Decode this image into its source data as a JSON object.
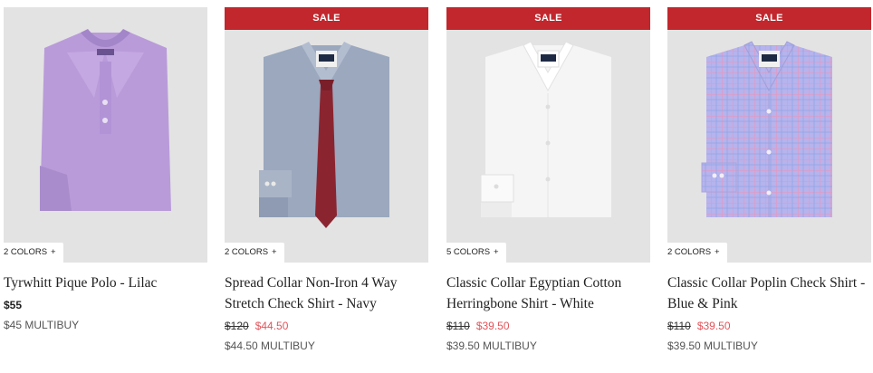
{
  "products": [
    {
      "name": "Tyrwhitt Pique Polo - Lilac",
      "sale_badge": "",
      "colors_label": "2 COLORS",
      "colors_plus": "+",
      "price": "$55",
      "old_price": "",
      "sale_price": "",
      "multibuy": "$45 MULTIBUY",
      "image": "lilac-polo-shirt",
      "color": "#b89bd8"
    },
    {
      "name": "Spread Collar Non-Iron 4 Way Stretch Check Shirt - Navy",
      "sale_badge": "SALE",
      "colors_label": "2 COLORS",
      "colors_plus": "+",
      "price": "",
      "old_price": "$120",
      "sale_price": "$44.50",
      "multibuy": "$44.50 MULTIBUY",
      "image": "navy-shirt-red-tie",
      "color": "#9aa8bf"
    },
    {
      "name": "Classic Collar Egyptian Cotton Herringbone Shirt - White",
      "sale_badge": "SALE",
      "colors_label": "5 COLORS",
      "colors_plus": "+",
      "price": "",
      "old_price": "$110",
      "sale_price": "$39.50",
      "multibuy": "$39.50 MULTIBUY",
      "image": "white-shirt",
      "color": "#f4f4f4"
    },
    {
      "name": "Classic Collar Poplin Check Shirt - Blue & Pink",
      "sale_badge": "SALE",
      "colors_label": "2 COLORS",
      "colors_plus": "+",
      "price": "",
      "old_price": "$110",
      "sale_price": "$39.50",
      "multibuy": "$39.50 MULTIBUY",
      "image": "blue-pink-check-shirt",
      "color": "#b9b4ea"
    }
  ],
  "colors": {
    "sale_banner": "#c1272d",
    "sale_price": "#e0545a",
    "image_bg": "#e3e3e3"
  }
}
